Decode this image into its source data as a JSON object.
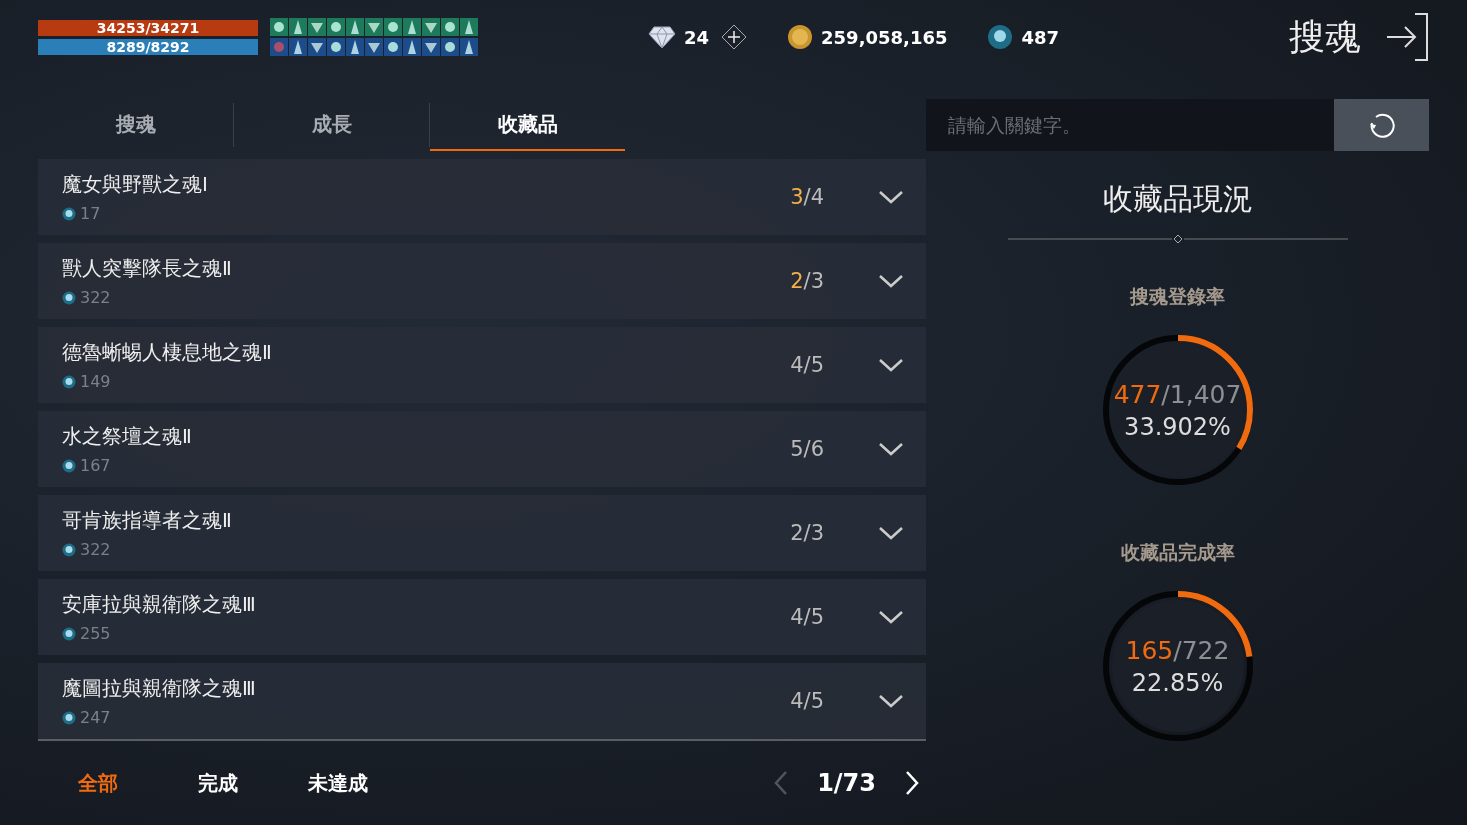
{
  "status": {
    "hp": {
      "text": "34253/34271",
      "level": 0.999
    },
    "mp": {
      "text": "8289/8292",
      "level": 0.999
    }
  },
  "currencies": [
    {
      "kind": "diamond",
      "amount": "24",
      "addable": true
    },
    {
      "kind": "gold",
      "amount": "259,058,165",
      "addable": false
    },
    {
      "kind": "soul",
      "amount": "487",
      "addable": false
    }
  ],
  "page_title": "搜魂",
  "tabs": [
    {
      "label": "搜魂",
      "selected": false
    },
    {
      "label": "成長",
      "selected": false
    },
    {
      "label": "收藏品",
      "selected": true
    }
  ],
  "search": {
    "placeholder": "請輸入關鍵字。"
  },
  "collections": [
    {
      "name": "魔女與野獸之魂Ⅰ",
      "souls": "17",
      "done": "3",
      "total": "/4",
      "highlight": true
    },
    {
      "name": "獸人突擊隊長之魂Ⅱ",
      "souls": "322",
      "done": "2",
      "total": "/3",
      "highlight": true
    },
    {
      "name": "德魯蜥蜴人棲息地之魂Ⅱ",
      "souls": "149",
      "done": "4",
      "total": "/5",
      "highlight": false
    },
    {
      "name": "水之祭壇之魂Ⅱ",
      "souls": "167",
      "done": "5",
      "total": "/6",
      "highlight": false
    },
    {
      "name": "哥肯族指導者之魂Ⅱ",
      "souls": "322",
      "done": "2",
      "total": "/3",
      "highlight": false
    },
    {
      "name": "安庫拉與親衛隊之魂Ⅲ",
      "souls": "255",
      "done": "4",
      "total": "/5",
      "highlight": false
    },
    {
      "name": "魔圖拉與親衛隊之魂Ⅲ",
      "souls": "247",
      "done": "4",
      "total": "/5",
      "highlight": false
    }
  ],
  "filters": [
    {
      "label": "全部",
      "selected": true
    },
    {
      "label": "完成",
      "selected": false
    },
    {
      "label": "未達成",
      "selected": false
    }
  ],
  "pager": {
    "text": "1/73",
    "prev_disabled": true,
    "next_disabled": false
  },
  "status_panel": {
    "title": "收藏品現況",
    "rates": [
      {
        "label": "搜魂登錄率",
        "count": "477",
        "total": "/1,407",
        "percent": "33.902%",
        "level": 0.339
      },
      {
        "label": "收藏品完成率",
        "count": "165",
        "total": "/722",
        "percent": "22.85%",
        "level": 0.2285
      }
    ]
  }
}
